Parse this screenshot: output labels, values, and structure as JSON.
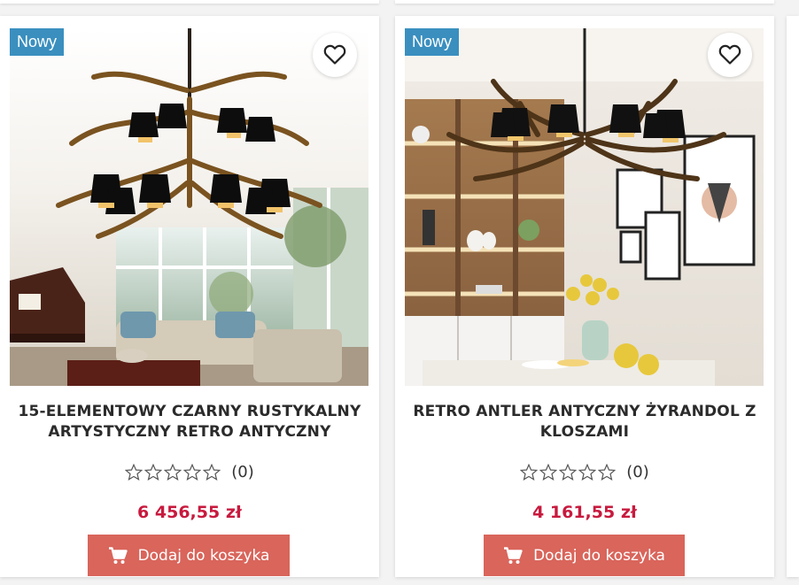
{
  "products": [
    {
      "badge": "Nowy",
      "title_line1": "15-ELEMENTOWY CZARNY RUSTYKALNY",
      "title_line2": "ARTYSTYCZNY RETRO ANTYCZNY",
      "rating": 0,
      "rating_max": 5,
      "reviews": "(0)",
      "price": "6 456,55 zł",
      "cart_label": "Dodaj do koszyka"
    },
    {
      "badge": "Nowy",
      "title_line1": "RETRO ANTLER ANTYCZNY ŻYRANDOL Z",
      "title_line2": "KLOSZAMI",
      "rating": 0,
      "rating_max": 5,
      "reviews": "(0)",
      "price": "4 161,55 zł",
      "cart_label": "Dodaj do koszyka"
    }
  ],
  "colors": {
    "badge": "#3a8fbf",
    "price": "#c81a3e",
    "cart_button": "#d9655b"
  },
  "icons": {
    "wishlist": "heart-outline-icon",
    "cart": "shopping-cart-icon",
    "star": "star-outline-icon"
  }
}
